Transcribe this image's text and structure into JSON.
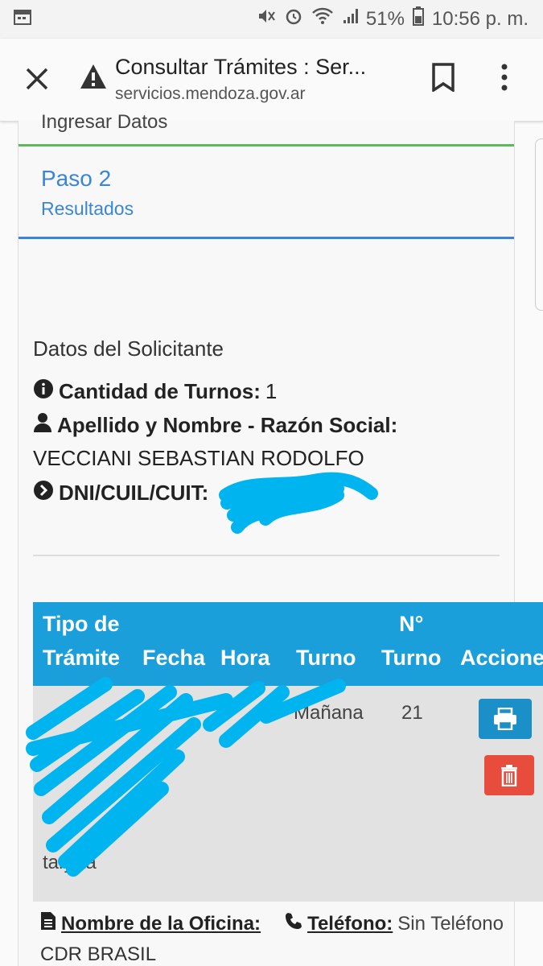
{
  "status_bar": {
    "battery": "51%",
    "time": "10:56 p. m."
  },
  "browser": {
    "page_title": "Consultar Trámites : Ser...",
    "url": "servicios.mendoza.gov.ar"
  },
  "steps": {
    "step1_label": "Ingresar Datos",
    "step2_title": "Paso 2",
    "step2_subtitle": "Resultados"
  },
  "solicitante": {
    "section_title": "Datos del Solicitante",
    "turnos_label": "Cantidad de Turnos:",
    "turnos_value": "1",
    "nombre_label": "Apellido y Nombre - Razón Social:",
    "nombre_value": "VECCIANI SEBASTIAN RODOLFO",
    "dni_label": "DNI/CUIL/CUIT:"
  },
  "table": {
    "headers": {
      "tipo_line1": "Tipo de",
      "tipo_line2": "Trámite",
      "fecha": "Fecha",
      "hora": "Hora",
      "turno": "Turno",
      "nro_line1": "N°",
      "nro_line2": "Turno",
      "acciones": "Acciones"
    },
    "row": {
      "turno": "Mañana",
      "nro": "21",
      "tipo_visible": "tarjeta"
    }
  },
  "office": {
    "name_label": "Nombre de la Oficina:",
    "phone_label": "Teléfono:",
    "phone_value": "Sin Teléfono",
    "name_value": "CDR BRASIL"
  },
  "colors": {
    "table_header": "#1a9fdb",
    "step_blue": "#3a86d4",
    "step_green": "#5cb85c",
    "delete_red": "#e74c3c",
    "redaction": "#00b4f0"
  }
}
